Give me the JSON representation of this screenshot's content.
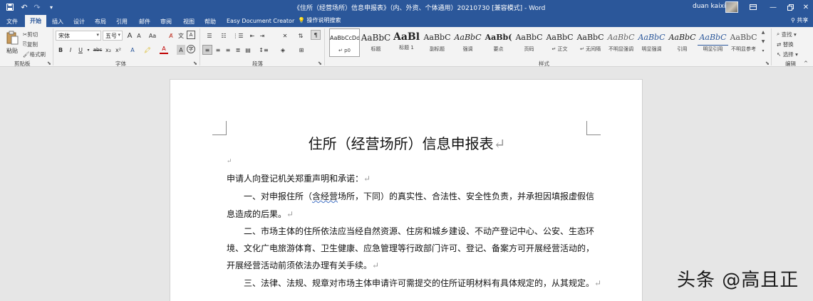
{
  "window": {
    "title": "《住所（经营场所）信息申报表》（内、外资、个体通用）20210730 [兼容模式] - Word",
    "user_name": "duan kaixin",
    "icons": {
      "save": "save-icon",
      "undo": "undo-icon",
      "redo": "redo-icon",
      "customize": "customize-qat-icon",
      "ribbon_display": "ribbon-display-icon",
      "minimize": "minimize-icon",
      "restore": "restore-icon",
      "close": "close-icon"
    }
  },
  "tabs": [
    {
      "label": "文件"
    },
    {
      "label": "开始",
      "active": true
    },
    {
      "label": "插入"
    },
    {
      "label": "设计"
    },
    {
      "label": "布局"
    },
    {
      "label": "引用"
    },
    {
      "label": "邮件"
    },
    {
      "label": "审阅"
    },
    {
      "label": "视图"
    },
    {
      "label": "帮助"
    },
    {
      "label": "Easy Document Creator"
    }
  ],
  "tell_me": "操作说明搜索",
  "share": "共享",
  "clipboard": {
    "paste": "粘贴",
    "cut": "剪切",
    "copy": "复制",
    "format_painter": "格式刷",
    "group": "剪贴板"
  },
  "font": {
    "name": "宋体",
    "size": "五号",
    "group": "字体",
    "grow": "A",
    "shrink": "A",
    "case": "Aa",
    "bold": "B",
    "italic": "I",
    "underline": "U",
    "strike": "abc",
    "sub": "x₂",
    "sup": "x²"
  },
  "paragraph": {
    "group": "段落"
  },
  "styles": {
    "group": "样式",
    "items": [
      {
        "sample": "AaBbCcDdI",
        "name": "↵ p0",
        "selected": true
      },
      {
        "sample": "AaBbC",
        "name": "标题"
      },
      {
        "sample": "AaBl",
        "name": "标题 1"
      },
      {
        "sample": "AaBbC",
        "name": "副标题"
      },
      {
        "sample": "AaBbC",
        "name": "强调"
      },
      {
        "sample": "AaBb(",
        "name": "要点"
      },
      {
        "sample": "AaBbC",
        "name": "页码"
      },
      {
        "sample": "AaBbC",
        "name": "↵ 正文"
      },
      {
        "sample": "AaBbC",
        "name": "↵ 无间隔"
      },
      {
        "sample": "AaBbC",
        "name": "不明显强调"
      },
      {
        "sample": "AaBbC",
        "name": "明显强调"
      },
      {
        "sample": "AaBbC",
        "name": "引用"
      },
      {
        "sample": "AaBbC",
        "name": "明显引用"
      },
      {
        "sample": "AaBbC",
        "name": "不明显参考"
      }
    ]
  },
  "editing": {
    "find": "查找",
    "replace": "替换",
    "select": "选择",
    "group": "编辑"
  },
  "document": {
    "title": "住所（经营场所）信息申报表",
    "para_mark": "↵",
    "intro": "申请人向登记机关郑重声明和承诺：",
    "p1_a": "一、对申报住所（",
    "p1_b": "含经营",
    "p1_c": "场所，下同）的真实性、合法性、安全性负责，并承担因填报虚假信",
    "p1_d": "息造成的后果。",
    "p2_a": "二、市场主体的住所依法应当经自然资源、住房和城乡建设、不动产登记中心、公安、生态环",
    "p2_b": "境、文化广电旅游体育、卫生健康、应急管理等行政部门许可、登记、备案方可开展经营活动的，",
    "p2_c": "开展经营活动前须依法办理有关手续。",
    "p3": "三、法律、法规、规章对市场主体申请许可需提交的住所证明材料有具体规定的，从其规定。"
  },
  "watermark": "头条 @高且正",
  "colors": {
    "accent": "#2b579a",
    "ribbon": "#f3f3f3",
    "canvas": "#e6e6e6"
  }
}
